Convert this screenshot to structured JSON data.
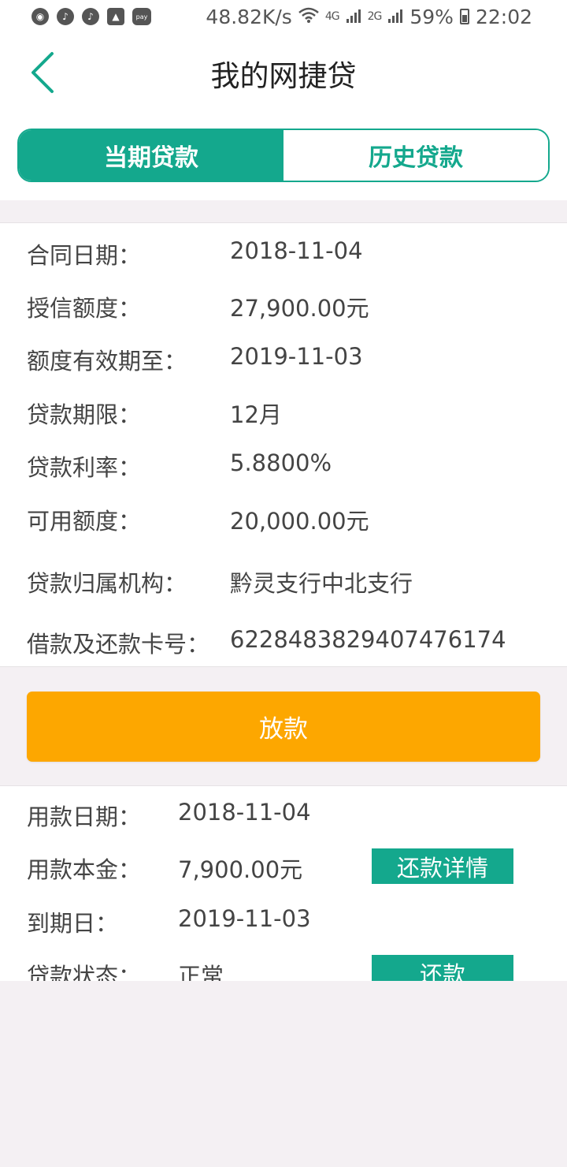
{
  "status_bar": {
    "speed": "48.82K/s",
    "net_4g": "4G",
    "net_2g": "2G",
    "battery": "59%",
    "time": "22:02",
    "pay_label": "pay"
  },
  "header": {
    "title": "我的网捷贷",
    "back_icon": "chevron-left-icon"
  },
  "tabs": [
    {
      "label": "当期贷款",
      "active": true
    },
    {
      "label": "历史贷款",
      "active": false
    }
  ],
  "loan_info": [
    {
      "label": "合同日期：",
      "value": "2018-11-04"
    },
    {
      "label": "授信额度：",
      "value": "27,900.00元"
    },
    {
      "label": "额度有效期至：",
      "value": "2019-11-03"
    },
    {
      "label": "贷款期限：",
      "value": "12月"
    },
    {
      "label": "贷款利率：",
      "value": "5.8800%"
    },
    {
      "label": "可用额度：",
      "value": "20,000.00元"
    },
    {
      "label": "贷款归属机构：",
      "value": "黔灵支行中北支行"
    },
    {
      "label": "借款及还款卡号：",
      "value": "6228483829407476174"
    }
  ],
  "release_button": {
    "label": "放款"
  },
  "drawdown": [
    {
      "label": "用款日期：",
      "value": "2018-11-04"
    },
    {
      "label": "用款本金：",
      "value": "7,900.00元",
      "button": "还款详情"
    },
    {
      "label": "到期日：",
      "value": "2019-11-03"
    },
    {
      "label": "贷款状态：",
      "value": "正常",
      "button": "还款"
    }
  ],
  "colors": {
    "accent": "#14a88d",
    "release": "#fda700",
    "background": "#f4f0f3"
  }
}
